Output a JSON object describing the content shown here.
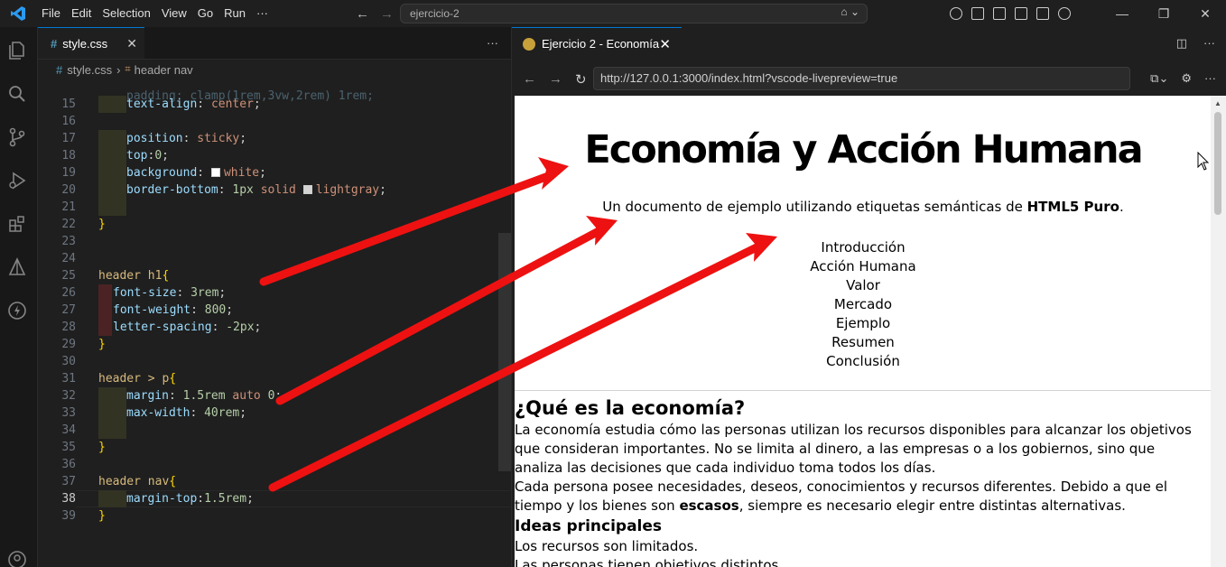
{
  "titlebar": {
    "menu": [
      "File",
      "Edit",
      "Selection",
      "View",
      "Go",
      "Run",
      "···"
    ],
    "search_text": "ejercicio-2",
    "window_controls": [
      "—",
      "❐",
      "✕"
    ]
  },
  "editor": {
    "tab_label": "style.css",
    "breadcrumb": {
      "file": "style.css",
      "symbol": "header nav"
    },
    "lines": [
      {
        "n": "15",
        "text": "text-align: center;"
      },
      {
        "n": "16",
        "text": ""
      },
      {
        "n": "17",
        "text": "position: sticky;"
      },
      {
        "n": "18",
        "text": "top:0;"
      },
      {
        "n": "19",
        "text": "background: white;"
      },
      {
        "n": "20",
        "text": "border-bottom: 1px solid lightgray;"
      },
      {
        "n": "21",
        "text": ""
      },
      {
        "n": "22",
        "text": "}"
      },
      {
        "n": "23",
        "text": ""
      },
      {
        "n": "24",
        "text": ""
      },
      {
        "n": "25",
        "text": "header h1{"
      },
      {
        "n": "26",
        "text": "font-size: 3rem;"
      },
      {
        "n": "27",
        "text": "font-weight: 800;"
      },
      {
        "n": "28",
        "text": "letter-spacing: -2px;"
      },
      {
        "n": "29",
        "text": "}"
      },
      {
        "n": "30",
        "text": ""
      },
      {
        "n": "31",
        "text": "header > p{"
      },
      {
        "n": "32",
        "text": "margin: 1.5rem auto 0;"
      },
      {
        "n": "33",
        "text": "max-width: 40rem;"
      },
      {
        "n": "34",
        "text": ""
      },
      {
        "n": "35",
        "text": "}"
      },
      {
        "n": "36",
        "text": ""
      },
      {
        "n": "37",
        "text": "header nav{"
      },
      {
        "n": "38",
        "text": "margin-top:1.5rem;"
      },
      {
        "n": "39",
        "text": "}"
      }
    ]
  },
  "preview": {
    "tab_label": "Ejercicio 2 - Economía",
    "url": "http://127.0.0.1:3000/index.html?vscode-livepreview=true",
    "page": {
      "title": "Economía y Acción Humana",
      "subtitle_pre": "Un documento de ejemplo utilizando etiquetas semánticas de ",
      "subtitle_bold": "HTML5 Puro",
      "subtitle_post": ".",
      "nav": [
        "Introducción",
        "Acción Humana",
        "Valor",
        "Mercado",
        "Ejemplo",
        "Resumen",
        "Conclusión"
      ],
      "section_title": "¿Qué es la economía?",
      "para1": "La economía estudia cómo las personas utilizan los recursos disponibles para alcanzar los objetivos que consideran importantes. No se limita al dinero, a las empresas o a los gobiernos, sino que analiza las decisiones que cada individuo toma todos los días.",
      "para2_pre": "Cada persona posee necesidades, deseos, conocimientos y recursos diferentes. Debido a que el tiempo y los bienes son ",
      "para2_bold": "escasos",
      "para2_post": ", siempre es necesario elegir entre distintas alternativas.",
      "subsection_title": "Ideas principales",
      "list1": "Los recursos son limitados.",
      "list2": "Las personas tienen objetivos distintos."
    }
  }
}
